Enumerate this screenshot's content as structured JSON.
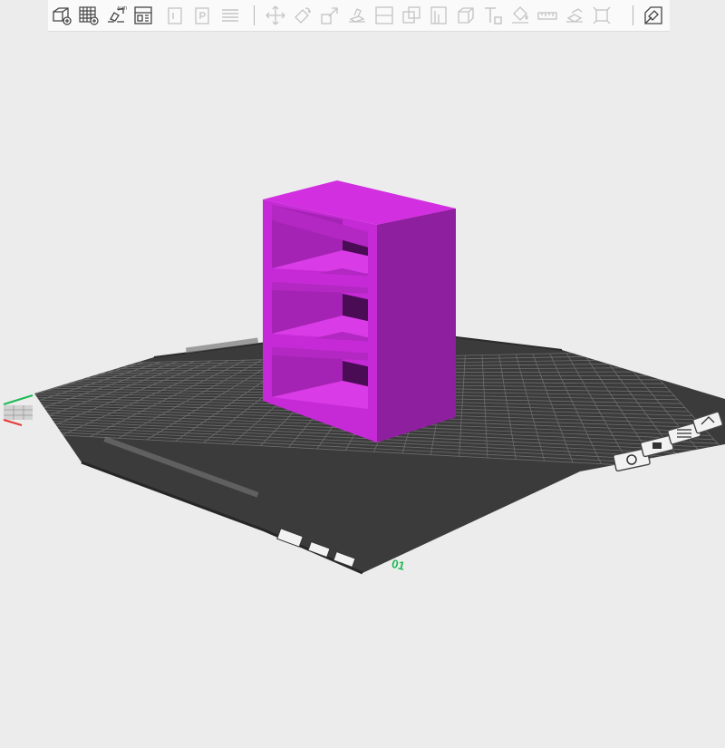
{
  "toolbar": {
    "groups": [
      [
        {
          "name": "add-object-icon",
          "enabled": true
        },
        {
          "name": "arrange-grid-icon",
          "enabled": true
        },
        {
          "name": "auto-orient-icon",
          "enabled": true
        },
        {
          "name": "plate-settings-icon",
          "enabled": true
        }
      ],
      [
        {
          "name": "copy-icon",
          "enabled": false
        },
        {
          "name": "paste-icon",
          "enabled": false
        },
        {
          "name": "layers-icon",
          "enabled": false
        }
      ],
      [
        {
          "name": "move-icon",
          "enabled": false
        },
        {
          "name": "rotate-icon",
          "enabled": false
        },
        {
          "name": "scale-icon",
          "enabled": false
        },
        {
          "name": "lay-on-face-icon",
          "enabled": false
        },
        {
          "name": "cut-icon",
          "enabled": false
        },
        {
          "name": "boolean-icon",
          "enabled": false
        },
        {
          "name": "support-paint-icon",
          "enabled": false
        },
        {
          "name": "seam-paint-icon",
          "enabled": false
        },
        {
          "name": "text-emboss-icon",
          "enabled": false
        },
        {
          "name": "color-paint-icon",
          "enabled": false
        },
        {
          "name": "measure-icon",
          "enabled": false
        },
        {
          "name": "assembly-icon",
          "enabled": false
        },
        {
          "name": "fit-view-icon",
          "enabled": false
        }
      ],
      [
        {
          "name": "variable-layer-height-icon",
          "enabled": true
        }
      ]
    ]
  },
  "plate": {
    "label": "01",
    "plate_icons": [
      "lock-icon",
      "arrange-icon",
      "orient-icon",
      "settings-icon"
    ]
  },
  "model": {
    "name": "bookshelf",
    "color": "#c62ad6"
  },
  "colors": {
    "toolbar_bg": "#fafafa",
    "viewport_bg": "#ececec",
    "bed": "#3b3b3b",
    "grid": "#6e6e6e",
    "accent": "#1db954"
  }
}
